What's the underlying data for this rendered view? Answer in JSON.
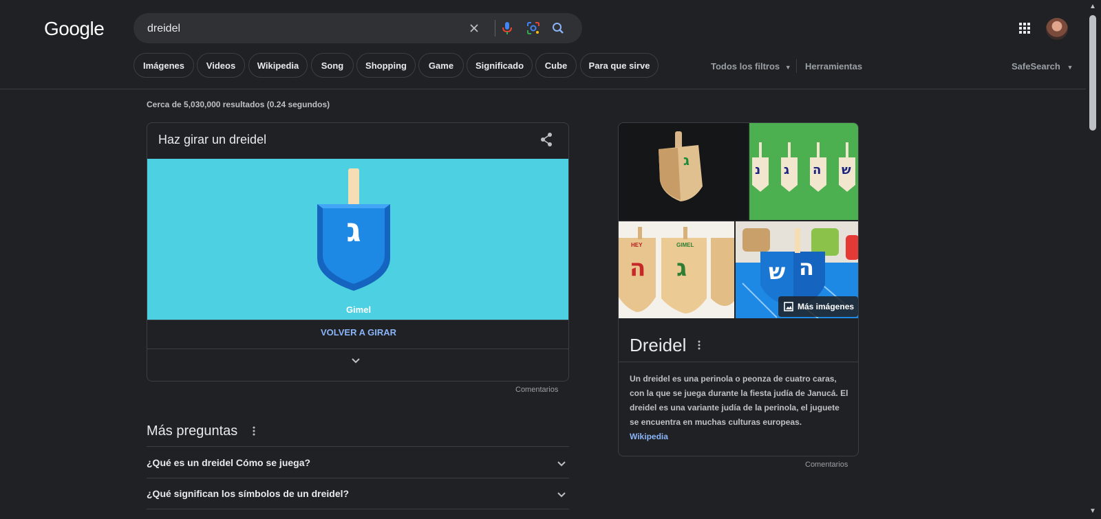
{
  "header": {
    "logo": "Google",
    "search_value": "dreidel",
    "icons": [
      "clear-icon",
      "mic-icon",
      "lens-icon",
      "search-icon",
      "apps-icon"
    ]
  },
  "chips": [
    "Imágenes",
    "Videos",
    "Wikipedia",
    "Song",
    "Shopping",
    "Game",
    "Significado",
    "Cube",
    "Para que sirve"
  ],
  "filters": {
    "all_filters": "Todos los filtros",
    "tools": "Herramientas",
    "safesearch": "SafeSearch"
  },
  "stats": "Cerca de 5,030,000 resultados (0.24 segundos)",
  "dreidel_card": {
    "title": "Haz girar un dreidel",
    "letter": "ג",
    "letter_name": "Gimel",
    "spin_again": "VOLVER A GIRAR",
    "feedback": "Comentarios",
    "stage_color": "#4dd0e1",
    "dreidel_color": "#1e88e5"
  },
  "questions": {
    "title": "Más preguntas",
    "items": [
      "¿Qué es un dreidel Cómo se juega?",
      "¿Qué significan los símbolos de un dreidel?"
    ]
  },
  "knowledge_panel": {
    "title": "Dreidel",
    "more_images": "Más imágenes",
    "description": "Un dreidel es una perinola o peonza de cuatro caras, con la que se juega durante la fiesta judía de Janucá. El dreidel es una variante judía de la perinola, el juguete se encuentra en muchas culturas europeas.",
    "source": "Wikipedia",
    "feedback": "Comentarios",
    "letters": [
      "ג",
      "נ",
      "ג",
      "ה",
      "ש",
      "ה",
      "ג",
      "ה",
      "ש"
    ],
    "label_words": [
      "HEY",
      "GIMEL"
    ]
  }
}
